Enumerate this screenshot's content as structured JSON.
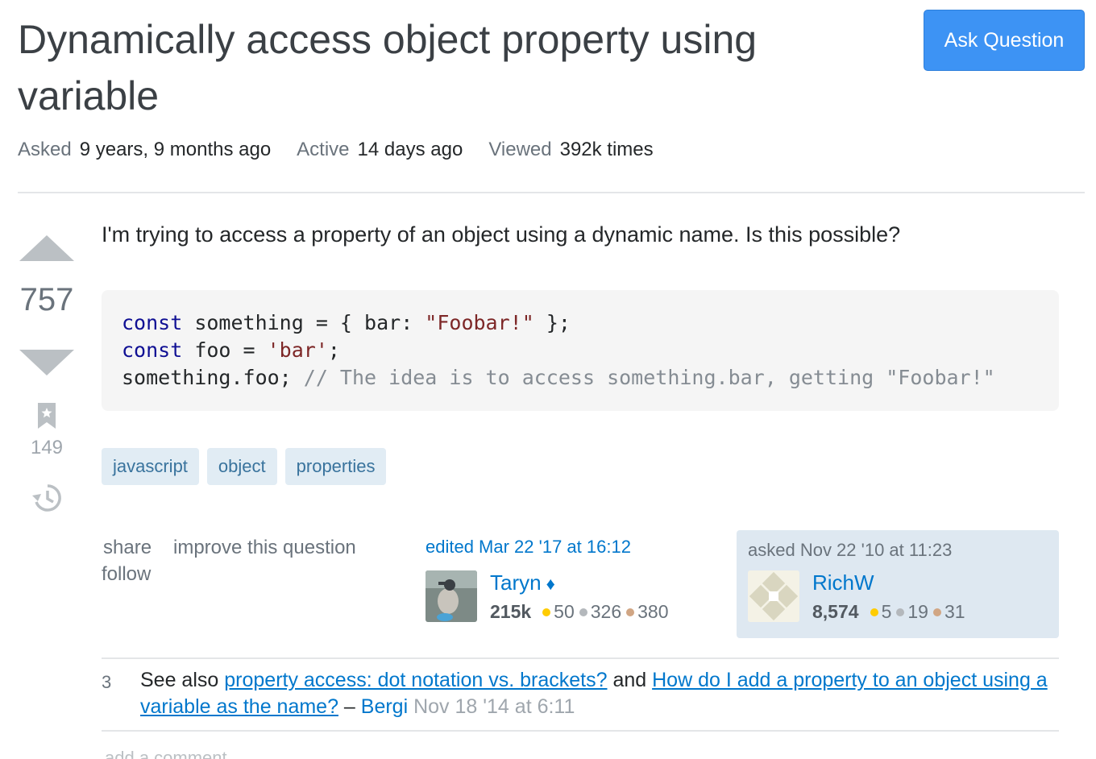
{
  "question": {
    "title": "Dynamically access object property using variable",
    "ask_button": "Ask Question",
    "meta": {
      "asked_label": "Asked",
      "asked_value": "9 years, 9 months ago",
      "active_label": "Active",
      "active_value": "14 days ago",
      "viewed_label": "Viewed",
      "viewed_value": "392k times"
    },
    "vote_count": "757",
    "bookmark_count": "149",
    "body_text": "I'm trying to access a property of an object using a dynamic name. Is this possible?",
    "code": {
      "line1": {
        "kw": "const",
        "a": " something = { bar: ",
        "str": "\"Foobar!\"",
        "b": " };"
      },
      "line2": {
        "kw": "const",
        "a": " foo = ",
        "str": "'bar'",
        "b": ";"
      },
      "line3": {
        "a": "something.foo; ",
        "comment": "// The idea is to access something.bar, getting \"Foobar!\""
      }
    },
    "tags": [
      "javascript",
      "object",
      "properties"
    ],
    "menu": {
      "share": "share",
      "improve": "improve this question",
      "follow": "follow"
    },
    "edited": {
      "time": "edited Mar 22 '17 at 16:12",
      "user": "Taryn",
      "moderator_mark": "♦",
      "reputation": "215k",
      "gold": "50",
      "silver": "326",
      "bronze": "380"
    },
    "asked": {
      "time": "asked Nov 22 '10 at 11:23",
      "user": "RichW",
      "reputation": "8,574",
      "gold": "5",
      "silver": "19",
      "bronze": "31"
    }
  },
  "comments": [
    {
      "score": "3",
      "prefix": "See also ",
      "link1": "property access: dot notation vs. brackets?",
      "middle": " and ",
      "link2": "How do I add a property to an object using a variable as the name?",
      "dash": " – ",
      "user": "Bergi",
      "date": " Nov 18 '14 at 6:11"
    }
  ],
  "add_comment": "add a comment",
  "colors": {
    "accent": "#3d93f4",
    "link": "#0077cc",
    "tag_bg": "#e1ecf4",
    "tag_text": "#39739d",
    "owner_card_bg": "#dee8f1"
  },
  "icons": [
    "vote-up-icon",
    "vote-down-icon",
    "bookmark-icon",
    "history-icon"
  ]
}
